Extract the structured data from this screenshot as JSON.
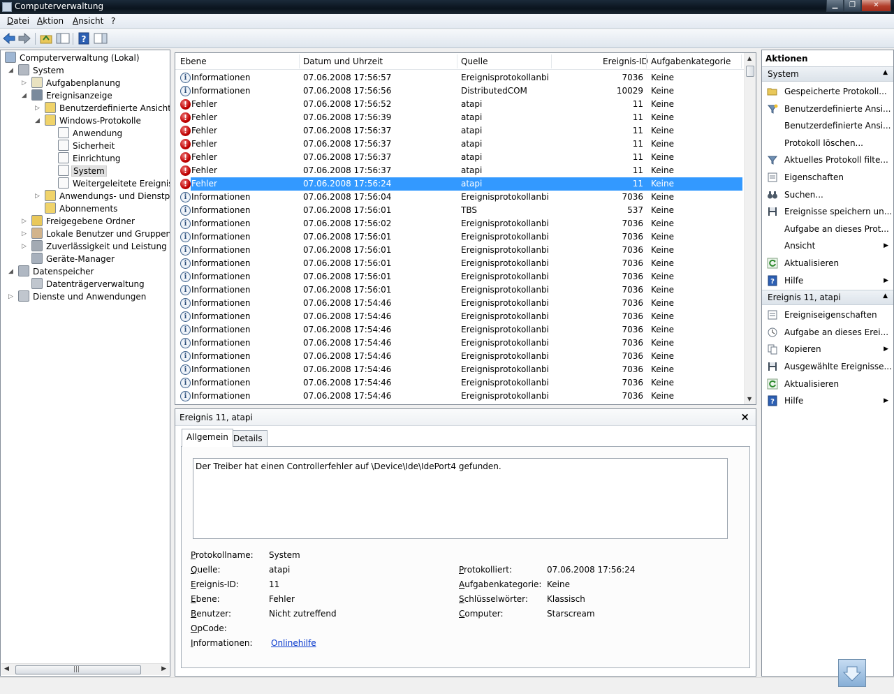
{
  "window": {
    "title": "Computerverwaltung"
  },
  "menu": [
    "Datei",
    "Aktion",
    "Ansicht",
    "?"
  ],
  "tree": [
    {
      "label": "Computerverwaltung (Lokal)",
      "depth": 0,
      "arrow": "",
      "icon": "computer-icon"
    },
    {
      "label": "System",
      "depth": 1,
      "arrow": "expanded",
      "icon": "tools-icon"
    },
    {
      "label": "Aufgabenplanung",
      "depth": 2,
      "arrow": "collapsed",
      "icon": "clock-icon"
    },
    {
      "label": "Ereignisanzeige",
      "depth": 2,
      "arrow": "expanded",
      "icon": "event-viewer-icon"
    },
    {
      "label": "Benutzerdefinierte Ansichten",
      "depth": 3,
      "arrow": "collapsed",
      "icon": "folder-icon"
    },
    {
      "label": "Windows-Protokolle",
      "depth": 3,
      "arrow": "expanded",
      "icon": "folder-icon"
    },
    {
      "label": "Anwendung",
      "depth": 4,
      "arrow": "",
      "icon": "log-icon"
    },
    {
      "label": "Sicherheit",
      "depth": 4,
      "arrow": "",
      "icon": "log-icon"
    },
    {
      "label": "Einrichtung",
      "depth": 4,
      "arrow": "",
      "icon": "log-icon"
    },
    {
      "label": "System",
      "depth": 4,
      "arrow": "",
      "icon": "log-icon",
      "selected": true
    },
    {
      "label": "Weitergeleitete Ereignisse",
      "depth": 4,
      "arrow": "",
      "icon": "log-icon"
    },
    {
      "label": "Anwendungs- und Dienstprotokolle",
      "depth": 3,
      "arrow": "collapsed",
      "icon": "folder-icon"
    },
    {
      "label": "Abonnements",
      "depth": 3,
      "arrow": "",
      "icon": "folder-icon"
    },
    {
      "label": "Freigegebene Ordner",
      "depth": 2,
      "arrow": "collapsed",
      "icon": "shared-folder-icon"
    },
    {
      "label": "Lokale Benutzer und Gruppen",
      "depth": 2,
      "arrow": "collapsed",
      "icon": "users-icon"
    },
    {
      "label": "Zuverlässigkeit und Leistung",
      "depth": 2,
      "arrow": "collapsed",
      "icon": "performance-icon"
    },
    {
      "label": "Geräte-Manager",
      "depth": 2,
      "arrow": "",
      "icon": "device-manager-icon"
    },
    {
      "label": "Datenspeicher",
      "depth": 1,
      "arrow": "expanded",
      "icon": "storage-icon"
    },
    {
      "label": "Datenträgerverwaltung",
      "depth": 2,
      "arrow": "",
      "icon": "disk-icon"
    },
    {
      "label": "Dienste und Anwendungen",
      "depth": 1,
      "arrow": "collapsed",
      "icon": "services-icon"
    }
  ],
  "list": {
    "columns": [
      "Ebene",
      "Datum und Uhrzeit",
      "Quelle",
      "Ereignis-ID",
      "Aufgabenkategorie"
    ],
    "rows": [
      {
        "level": "Informationen",
        "type": "info",
        "date": "07.06.2008 17:56:57",
        "source": "Ereignisprotokollanbi...",
        "id": "7036",
        "cat": "Keine"
      },
      {
        "level": "Informationen",
        "type": "info",
        "date": "07.06.2008 17:56:56",
        "source": "DistributedCOM",
        "id": "10029",
        "cat": "Keine"
      },
      {
        "level": "Fehler",
        "type": "error",
        "date": "07.06.2008 17:56:52",
        "source": "atapi",
        "id": "11",
        "cat": "Keine"
      },
      {
        "level": "Fehler",
        "type": "error",
        "date": "07.06.2008 17:56:39",
        "source": "atapi",
        "id": "11",
        "cat": "Keine"
      },
      {
        "level": "Fehler",
        "type": "error",
        "date": "07.06.2008 17:56:37",
        "source": "atapi",
        "id": "11",
        "cat": "Keine"
      },
      {
        "level": "Fehler",
        "type": "error",
        "date": "07.06.2008 17:56:37",
        "source": "atapi",
        "id": "11",
        "cat": "Keine"
      },
      {
        "level": "Fehler",
        "type": "error",
        "date": "07.06.2008 17:56:37",
        "source": "atapi",
        "id": "11",
        "cat": "Keine"
      },
      {
        "level": "Fehler",
        "type": "error",
        "date": "07.06.2008 17:56:37",
        "source": "atapi",
        "id": "11",
        "cat": "Keine"
      },
      {
        "level": "Fehler",
        "type": "error",
        "date": "07.06.2008 17:56:24",
        "source": "atapi",
        "id": "11",
        "cat": "Keine",
        "selected": true
      },
      {
        "level": "Informationen",
        "type": "info",
        "date": "07.06.2008 17:56:04",
        "source": "Ereignisprotokollanbi...",
        "id": "7036",
        "cat": "Keine"
      },
      {
        "level": "Informationen",
        "type": "info",
        "date": "07.06.2008 17:56:01",
        "source": "TBS",
        "id": "537",
        "cat": "Keine"
      },
      {
        "level": "Informationen",
        "type": "info",
        "date": "07.06.2008 17:56:02",
        "source": "Ereignisprotokollanbi...",
        "id": "7036",
        "cat": "Keine"
      },
      {
        "level": "Informationen",
        "type": "info",
        "date": "07.06.2008 17:56:01",
        "source": "Ereignisprotokollanbi...",
        "id": "7036",
        "cat": "Keine"
      },
      {
        "level": "Informationen",
        "type": "info",
        "date": "07.06.2008 17:56:01",
        "source": "Ereignisprotokollanbi...",
        "id": "7036",
        "cat": "Keine"
      },
      {
        "level": "Informationen",
        "type": "info",
        "date": "07.06.2008 17:56:01",
        "source": "Ereignisprotokollanbi...",
        "id": "7036",
        "cat": "Keine"
      },
      {
        "level": "Informationen",
        "type": "info",
        "date": "07.06.2008 17:56:01",
        "source": "Ereignisprotokollanbi...",
        "id": "7036",
        "cat": "Keine"
      },
      {
        "level": "Informationen",
        "type": "info",
        "date": "07.06.2008 17:56:01",
        "source": "Ereignisprotokollanbi...",
        "id": "7036",
        "cat": "Keine"
      },
      {
        "level": "Informationen",
        "type": "info",
        "date": "07.06.2008 17:54:46",
        "source": "Ereignisprotokollanbi...",
        "id": "7036",
        "cat": "Keine"
      },
      {
        "level": "Informationen",
        "type": "info",
        "date": "07.06.2008 17:54:46",
        "source": "Ereignisprotokollanbi...",
        "id": "7036",
        "cat": "Keine"
      },
      {
        "level": "Informationen",
        "type": "info",
        "date": "07.06.2008 17:54:46",
        "source": "Ereignisprotokollanbi...",
        "id": "7036",
        "cat": "Keine"
      },
      {
        "level": "Informationen",
        "type": "info",
        "date": "07.06.2008 17:54:46",
        "source": "Ereignisprotokollanbi...",
        "id": "7036",
        "cat": "Keine"
      },
      {
        "level": "Informationen",
        "type": "info",
        "date": "07.06.2008 17:54:46",
        "source": "Ereignisprotokollanbi...",
        "id": "7036",
        "cat": "Keine"
      },
      {
        "level": "Informationen",
        "type": "info",
        "date": "07.06.2008 17:54:46",
        "source": "Ereignisprotokollanbi...",
        "id": "7036",
        "cat": "Keine"
      },
      {
        "level": "Informationen",
        "type": "info",
        "date": "07.06.2008 17:54:46",
        "source": "Ereignisprotokollanbi...",
        "id": "7036",
        "cat": "Keine"
      },
      {
        "level": "Informationen",
        "type": "info",
        "date": "07.06.2008 17:54:46",
        "source": "Ereignisprotokollanbi...",
        "id": "7036",
        "cat": "Keine"
      }
    ]
  },
  "detail": {
    "title": "Ereignis 11, atapi",
    "tabs": [
      "Allgemein",
      "Details"
    ],
    "message": "Der Treiber hat einen Controllerfehler auf \\Device\\Ide\\IdePort4 gefunden.",
    "fields_left": [
      {
        "label": "Protokollname:",
        "value": "System"
      },
      {
        "label": "Quelle:",
        "value": "atapi"
      },
      {
        "label": "Ereignis-ID:",
        "value": "11"
      },
      {
        "label": "Ebene:",
        "value": "Fehler"
      },
      {
        "label": "Benutzer:",
        "value": "Nicht zutreffend"
      },
      {
        "label": "OpCode:",
        "value": ""
      },
      {
        "label": "Informationen:",
        "value": "Onlinehilfe"
      }
    ],
    "fields_right": [
      {
        "label": "Protokolliert:",
        "value": "07.06.2008 17:56:24"
      },
      {
        "label": "Aufgabenkategorie:",
        "value": "Keine"
      },
      {
        "label": "Schlüsselwörter:",
        "value": "Klassisch"
      },
      {
        "label": "Computer:",
        "value": "Starscream"
      }
    ]
  },
  "actions": {
    "title": "Aktionen",
    "sections": [
      {
        "title": "System",
        "items": [
          {
            "label": "Gespeicherte Protokoll...",
            "icon": "open-folder-icon",
            "sub": false
          },
          {
            "label": "Benutzerdefinierte Ansi...",
            "icon": "filter-new-icon",
            "sub": false
          },
          {
            "label": "Benutzerdefinierte Ansi...",
            "icon": "",
            "sub": false
          },
          {
            "label": "Protokoll löschen...",
            "icon": "",
            "sub": false
          },
          {
            "label": "Aktuelles Protokoll filte...",
            "icon": "filter-icon",
            "sub": false
          },
          {
            "label": "Eigenschaften",
            "icon": "properties-icon",
            "sub": false
          },
          {
            "label": "Suchen...",
            "icon": "binoculars-icon",
            "sub": false
          },
          {
            "label": "Ereignisse speichern un...",
            "icon": "save-icon",
            "sub": false
          },
          {
            "label": "Aufgabe an dieses Prot...",
            "icon": "",
            "sub": false
          },
          {
            "label": "Ansicht",
            "icon": "",
            "sub": true
          },
          {
            "label": "Aktualisieren",
            "icon": "refresh-icon",
            "sub": false
          },
          {
            "label": "Hilfe",
            "icon": "help-icon",
            "sub": true
          }
        ]
      },
      {
        "title": "Ereignis 11, atapi",
        "items": [
          {
            "label": "Ereigniseigenschaften",
            "icon": "properties-icon",
            "sub": false
          },
          {
            "label": "Aufgabe an dieses Erei...",
            "icon": "task-icon",
            "sub": false
          },
          {
            "label": "Kopieren",
            "icon": "copy-icon",
            "sub": true
          },
          {
            "label": "Ausgewählte Ereignisse...",
            "icon": "save-icon",
            "sub": false
          },
          {
            "label": "Aktualisieren",
            "icon": "refresh-icon",
            "sub": false
          },
          {
            "label": "Hilfe",
            "icon": "help-icon",
            "sub": true
          }
        ]
      }
    ]
  },
  "colors": {
    "selection": "#3399ff",
    "error": "#c00000",
    "info": "#2a4d7a",
    "link": "#0033cc"
  }
}
